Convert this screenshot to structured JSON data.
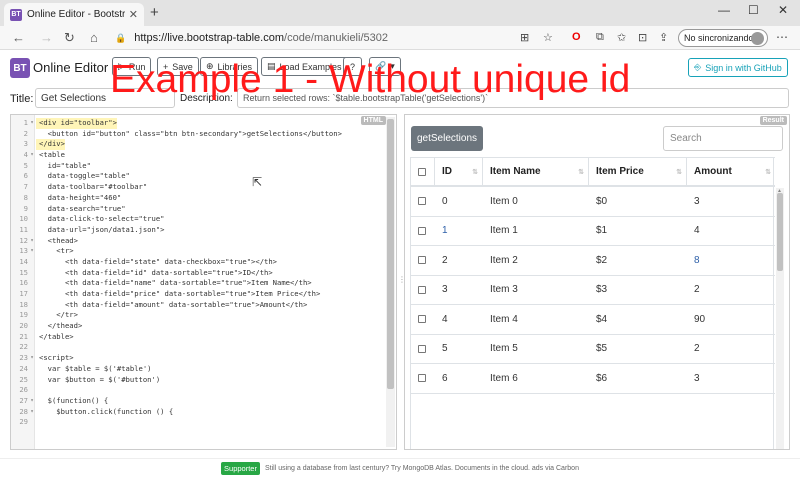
{
  "browser": {
    "tab_title": "Online Editor - Bootstrap Table",
    "tab_icon": "BT",
    "url_host": "https://live.bootstrap-table.com",
    "url_path": "/code/manukieli/5302",
    "profile_label": "No sincronizando"
  },
  "app": {
    "logo_text": "BT",
    "name": "Online Editor",
    "buttons": {
      "run": "Run",
      "save": "Save",
      "libraries": "Libraries",
      "load_examples": "Load Examples",
      "help": "?",
      "share": "•"
    },
    "github": "Sign in with GitHub",
    "overlay": "Example 1 - Without unique id"
  },
  "form": {
    "title_label": "Title:",
    "title_value": "Get Selections",
    "description_label": "Description:",
    "description_value": "Return selected rows: `$table.bootstrapTable('getSelections')`"
  },
  "editor": {
    "badge": "HTML",
    "lines": [
      {
        "n": "1",
        "f": "▾",
        "t": "<div id=\"toolbar\">",
        "hl": true
      },
      {
        "n": "2",
        "f": "",
        "t": "  <button id=\"button\" class=\"btn btn-secondary\">getSelections</button>"
      },
      {
        "n": "3",
        "f": "",
        "t": "</div>",
        "hl": true
      },
      {
        "n": "4",
        "f": "▾",
        "t": "<table"
      },
      {
        "n": "5",
        "f": "",
        "t": "  id=\"table\""
      },
      {
        "n": "6",
        "f": "",
        "t": "  data-toggle=\"table\""
      },
      {
        "n": "7",
        "f": "",
        "t": "  data-toolbar=\"#toolbar\""
      },
      {
        "n": "8",
        "f": "",
        "t": "  data-height=\"460\""
      },
      {
        "n": "9",
        "f": "",
        "t": "  data-search=\"true\""
      },
      {
        "n": "10",
        "f": "",
        "t": "  data-click-to-select=\"true\""
      },
      {
        "n": "11",
        "f": "",
        "t": "  data-url=\"json/data1.json\">"
      },
      {
        "n": "12",
        "f": "▾",
        "t": "  <thead>"
      },
      {
        "n": "13",
        "f": "▾",
        "t": "    <tr>"
      },
      {
        "n": "14",
        "f": "",
        "t": "      <th data-field=\"state\" data-checkbox=\"true\"></th>"
      },
      {
        "n": "15",
        "f": "",
        "t": "      <th data-field=\"id\" data-sortable=\"true\">ID</th>"
      },
      {
        "n": "16",
        "f": "",
        "t": "      <th data-field=\"name\" data-sortable=\"true\">Item Name</th>"
      },
      {
        "n": "17",
        "f": "",
        "t": "      <th data-field=\"price\" data-sortable=\"true\">Item Price</th>"
      },
      {
        "n": "18",
        "f": "",
        "t": "      <th data-field=\"amount\" data-sortable=\"true\">Amount</th>"
      },
      {
        "n": "19",
        "f": "",
        "t": "    </tr>"
      },
      {
        "n": "20",
        "f": "",
        "t": "  </thead>"
      },
      {
        "n": "21",
        "f": "",
        "t": "</table>"
      },
      {
        "n": "22",
        "f": "",
        "t": ""
      },
      {
        "n": "23",
        "f": "▾",
        "t": "<script>"
      },
      {
        "n": "24",
        "f": "",
        "t": "  var $table = $('#table')"
      },
      {
        "n": "25",
        "f": "",
        "t": "  var $button = $('#button')"
      },
      {
        "n": "26",
        "f": "",
        "t": ""
      },
      {
        "n": "27",
        "f": "▾",
        "t": "  $(function() {"
      },
      {
        "n": "28",
        "f": "▾",
        "t": "    $button.click(function () {"
      },
      {
        "n": "29",
        "f": "",
        "t": ""
      }
    ]
  },
  "result": {
    "badge": "Result",
    "button": "getSelections",
    "search_placeholder": "Search",
    "columns": [
      "ID",
      "Item Name",
      "Item Price",
      "Amount"
    ],
    "rows": [
      {
        "id": "0",
        "name": "Item 0",
        "price": "$0",
        "amount": "3",
        "id_blue": false,
        "amt_blue": false
      },
      {
        "id": "1",
        "name": "Item 1",
        "price": "$1",
        "amount": "4",
        "id_blue": true,
        "amt_blue": false
      },
      {
        "id": "2",
        "name": "Item 2",
        "price": "$2",
        "amount": "8",
        "id_blue": false,
        "amt_blue": true
      },
      {
        "id": "3",
        "name": "Item 3",
        "price": "$3",
        "amount": "2",
        "id_blue": false,
        "amt_blue": false
      },
      {
        "id": "4",
        "name": "Item 4",
        "price": "$4",
        "amount": "90",
        "id_blue": false,
        "amt_blue": false
      },
      {
        "id": "5",
        "name": "Item 5",
        "price": "$5",
        "amount": "2",
        "id_blue": false,
        "amt_blue": false
      },
      {
        "id": "6",
        "name": "Item 6",
        "price": "$6",
        "amount": "3",
        "id_blue": false,
        "amt_blue": false
      }
    ]
  },
  "footer": {
    "badge": "Supporter",
    "text": "Still using a database from last century? Try MongoDB Atlas. Documents in the cloud. ads via Carbon"
  },
  "colors": {
    "brand": "#7952b3",
    "overlay": "#ff1a1a",
    "secondary": "#6c757d",
    "github": "#17a2b8",
    "supporter": "#28a745",
    "link_blue": "#2d5fa8"
  }
}
